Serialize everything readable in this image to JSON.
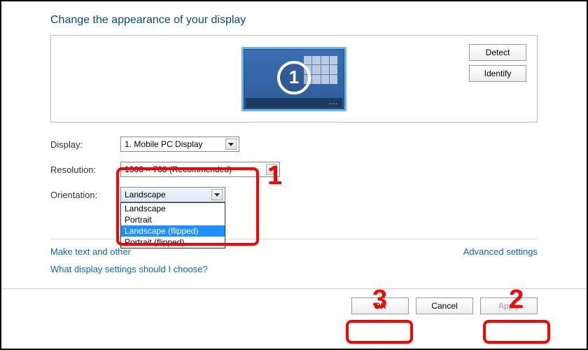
{
  "heading": "Change the appearance of your display",
  "monitor_number": "1",
  "side_buttons": {
    "detect": "Detect",
    "identify": "Identify"
  },
  "labels": {
    "display": "Display:",
    "resolution": "Resolution:",
    "orientation": "Orientation:"
  },
  "display_value": "1. Mobile PC Display",
  "resolution_value": "1366 × 768 (Recommended)",
  "orientation_value": "Landscape",
  "orientation_options": [
    "Landscape",
    "Portrait",
    "Landscape (flipped)",
    "Portrait (flipped)"
  ],
  "orientation_highlighted_index": 2,
  "links": {
    "make_text": "Make text and other",
    "advanced": "Advanced settings",
    "help": "What display settings should I choose?"
  },
  "footer": {
    "ok": "OK",
    "cancel": "Cancel",
    "apply": "Apply"
  },
  "annotations": {
    "n1": "1",
    "n2": "2",
    "n3": "3"
  }
}
